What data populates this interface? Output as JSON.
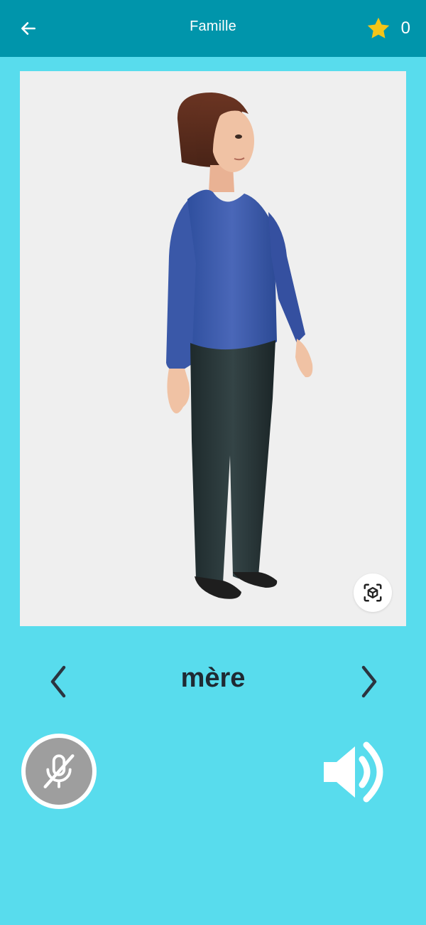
{
  "header": {
    "back_icon": "arrow-left-icon",
    "title": "Famille",
    "star_icon": "star-icon",
    "star_color": "#f5c518",
    "score": "0"
  },
  "colors": {
    "background": "#58dced",
    "topbar": "#0095ab",
    "card": "#efefef",
    "word": "#1f2a33"
  },
  "viewer": {
    "subject": "3d-woman-model",
    "ar_icon": "ar-cube-icon"
  },
  "word_nav": {
    "prev_icon": "chevron-left-icon",
    "word": "mère",
    "next_icon": "chevron-right-icon"
  },
  "controls": {
    "mic_icon": "microphone-off-icon",
    "speaker_icon": "speaker-icon"
  }
}
